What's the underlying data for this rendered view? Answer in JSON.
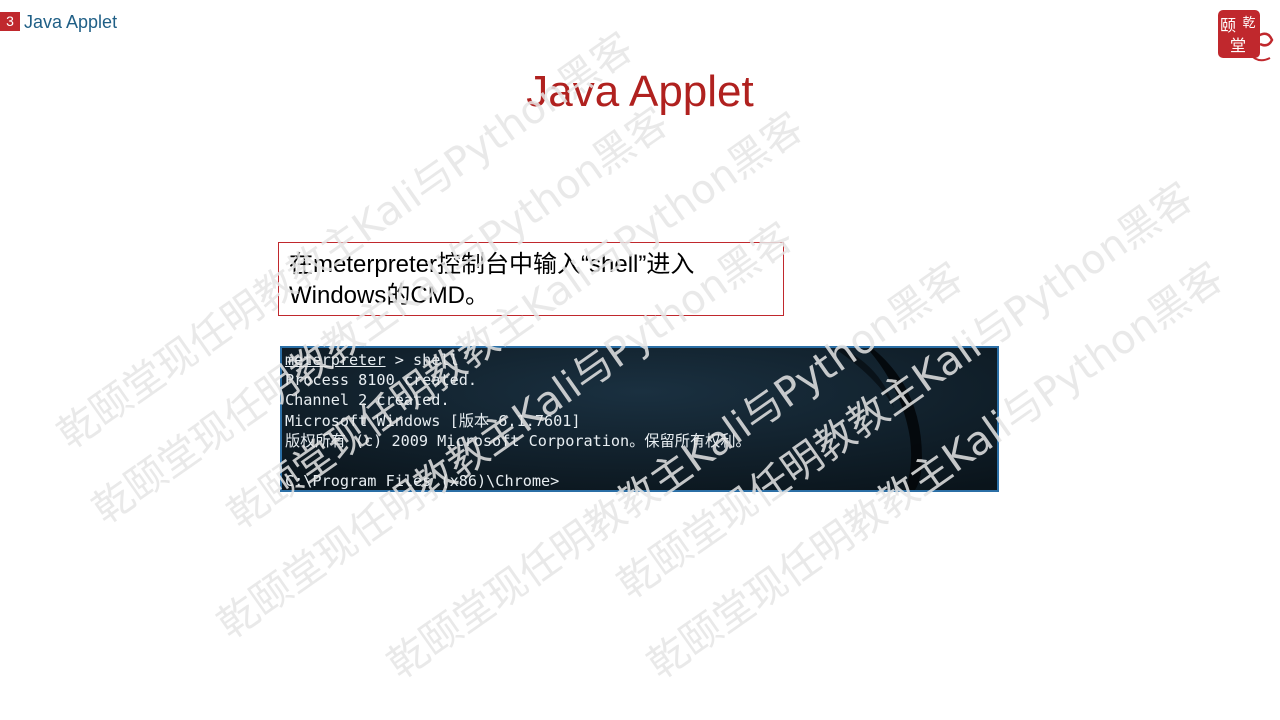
{
  "header": {
    "slide_number": "3",
    "section_title": "Java Applet"
  },
  "logo": {
    "characters": [
      "颐",
      "乾",
      "堂"
    ]
  },
  "slide": {
    "title": "Java Applet",
    "callout_line1": "在meterpreter控制台中输入“shell”进入",
    "callout_line2": "Windows的CMD。"
  },
  "terminal": {
    "prompt": "meterpreter",
    "command": " > shell",
    "lines": [
      "Process 8100 created.",
      "Channel 2 created.",
      "Microsoft Windows [版本 6.1.7601]",
      "版权所有 (c) 2009 Microsoft Corporation。保留所有权利。",
      "",
      "C:\\Program Files (x86)\\Chrome>"
    ]
  },
  "watermark": {
    "text_a": "乾颐堂现任明教教主Kali与Python黑客",
    "color": "#e6e6e6"
  },
  "colors": {
    "accent_red": "#c0282d",
    "title_red": "#b0211f",
    "header_blue": "#1f5f86",
    "terminal_bg": "#0c1820",
    "terminal_border": "#2b6fa6"
  }
}
